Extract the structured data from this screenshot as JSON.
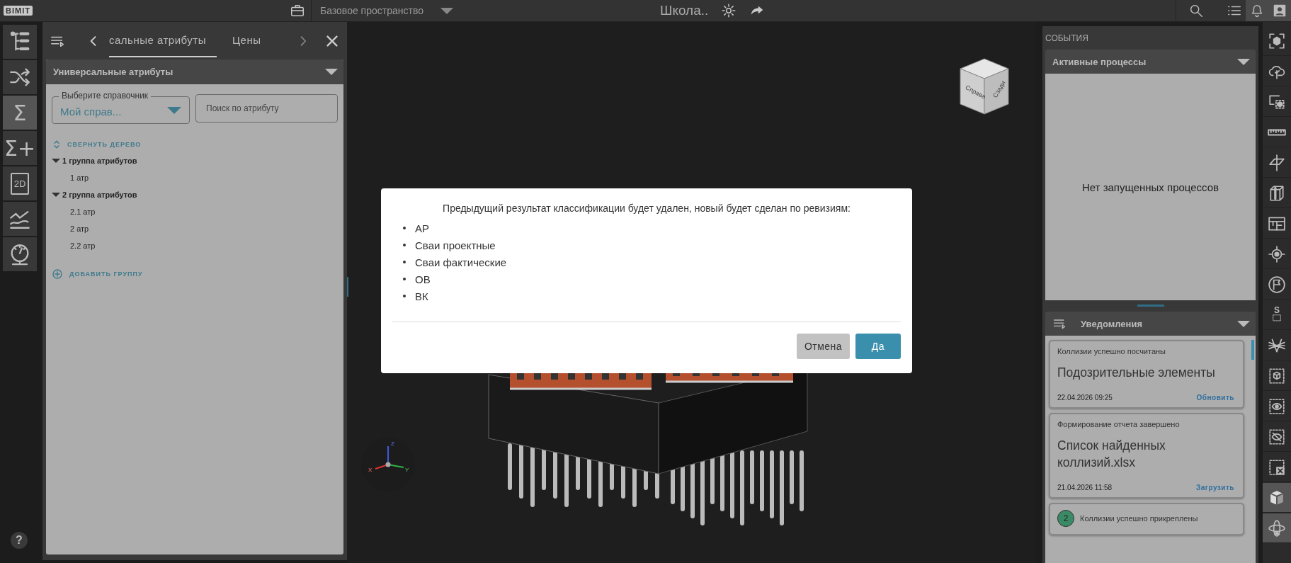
{
  "top_bar": {
    "logo": "BIMIT",
    "workspace": "Базовое пространство",
    "project_title": "Школа..",
    "actions": [
      {
        "kind": "search",
        "selected": false
      },
      {
        "kind": "list",
        "selected": false
      },
      {
        "kind": "sync",
        "selected": true
      },
      {
        "kind": "user",
        "selected": true
      }
    ]
  },
  "left_rail": {
    "items": [
      {
        "kind": "tree",
        "selected": false
      },
      {
        "kind": "shuffle",
        "selected": false
      },
      {
        "kind": "glyph",
        "text": "Σ",
        "selected": true
      },
      {
        "kind": "glyph",
        "text": "Σ+",
        "selected": false
      },
      {
        "kind": "sheet",
        "text": "2D",
        "selected": false
      },
      {
        "kind": "chart",
        "selected": false
      },
      {
        "kind": "gauge",
        "selected": false
      }
    ],
    "help": "?"
  },
  "left_panel": {
    "tabs": [
      {
        "label": "сальные атрибуты",
        "selected": true
      },
      {
        "label": "Цены",
        "selected": false
      }
    ],
    "section": {
      "title": "Универсальные атрибуты",
      "expanded": true
    },
    "reference_field": {
      "label": "Выберите справочник",
      "value": "Мой справ..."
    },
    "search": {
      "placeholder": "Поиск по атрибуту"
    },
    "collapse_link": "СВЕРНУТЬ ДЕРЕВО",
    "tree": [
      {
        "label": "1 группа атрибутов",
        "expanded": true,
        "children": [
          {
            "label": "1 атр"
          }
        ]
      },
      {
        "label": "2 группа атрибутов",
        "expanded": true,
        "children": [
          {
            "label": "2.1 атр"
          },
          {
            "label": "2 атр"
          },
          {
            "label": "2.2 атр"
          }
        ]
      }
    ],
    "add_group": "ДОБАВИТЬ ГРУППУ"
  },
  "viewport": {
    "view_cube": {
      "right_face": "Справа",
      "back_face": "Сзади"
    },
    "axes": {
      "x": "X",
      "y": "Y",
      "z": "Z"
    }
  },
  "dialog": {
    "message": "Предыдущий результат классификации будет удален, новый будет сделан по ревизиям:",
    "items": [
      "АР",
      "Сваи проектные",
      "Сваи фактические",
      "ОВ",
      "ВК"
    ],
    "buttons": [
      {
        "label": "Отмена",
        "kind": "secondary"
      },
      {
        "label": "Да",
        "kind": "primary"
      }
    ]
  },
  "right_panel": {
    "title": "СОБЫТИЯ",
    "processes": {
      "title": "Активные процессы",
      "expanded": true,
      "empty_text": "Нет запущенных процессов"
    },
    "notifications": {
      "title": "Уведомления",
      "expanded": true,
      "items": [
        {
          "title": "Коллизии успешно посчитаны",
          "name": "Подозрительные элементы",
          "date": "22.04.2026 09:25",
          "action": "Обновить"
        },
        {
          "title": "Формирование отчета завершено",
          "name": "Список найденных коллизий.xlsx",
          "date": "21.04.2026 11:58",
          "action": "Загрузить"
        },
        {
          "badge": "2",
          "title": "Коллизии успешно прикреплены"
        }
      ]
    }
  },
  "right_toolbar": {
    "items": [
      {
        "kind": "focus",
        "selected": false
      },
      {
        "kind": "cloud",
        "selected": false
      },
      {
        "kind": "screen",
        "selected": false
      },
      {
        "kind": "ruler",
        "selected": false
      },
      {
        "kind": "plane",
        "selected": false
      },
      {
        "kind": "section",
        "selected": false
      },
      {
        "kind": "plan",
        "selected": false
      },
      {
        "kind": "target",
        "selected": false
      },
      {
        "kind": "flag",
        "selected": false
      },
      {
        "kind": "measure",
        "text": "S",
        "selected": false
      },
      {
        "kind": "grid",
        "selected": false
      },
      {
        "kind": "boxsel",
        "selected": false
      },
      {
        "kind": "eyesel",
        "selected": false
      },
      {
        "kind": "eyeoff",
        "selected": false
      },
      {
        "kind": "xsel",
        "selected": false
      },
      {
        "kind": "cube",
        "selected": true
      },
      {
        "kind": "orbit",
        "selected": true
      }
    ]
  }
}
